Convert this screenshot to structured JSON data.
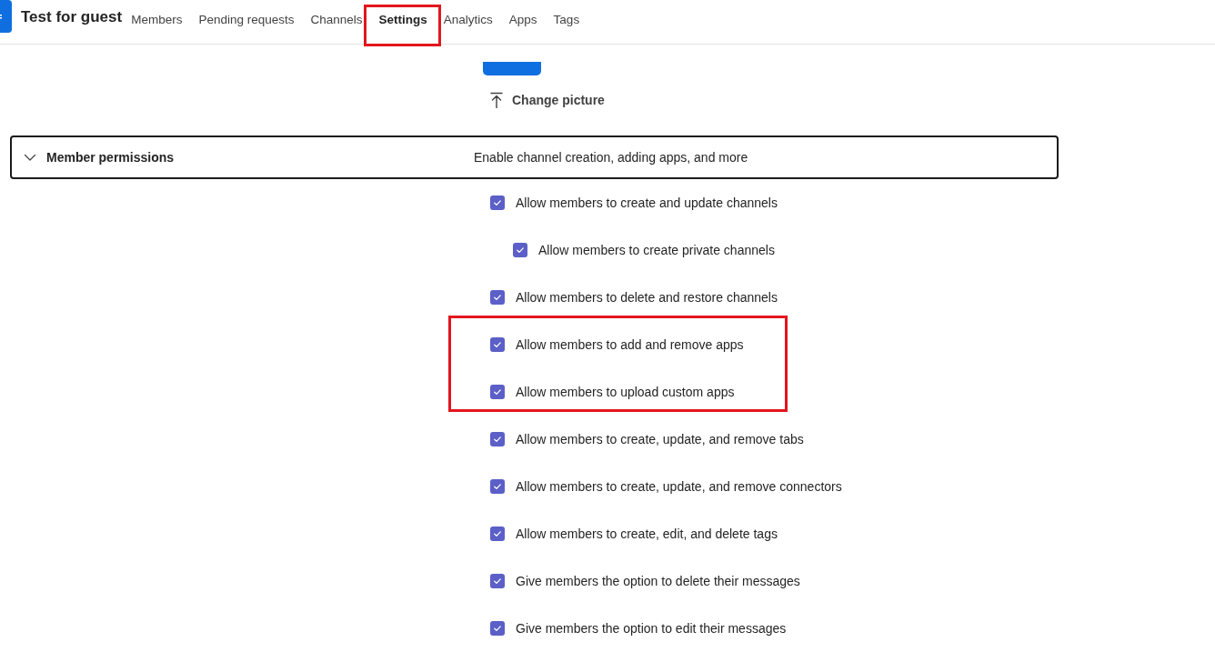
{
  "header": {
    "title": "Test for guest",
    "tabs": [
      {
        "label": "Members",
        "selected": false,
        "highlighted": false
      },
      {
        "label": "Pending requests",
        "selected": false,
        "highlighted": false
      },
      {
        "label": "Channels",
        "selected": false,
        "highlighted": false
      },
      {
        "label": "Settings",
        "selected": true,
        "highlighted": true
      },
      {
        "label": "Analytics",
        "selected": false,
        "highlighted": false
      },
      {
        "label": "Apps",
        "selected": false,
        "highlighted": false
      },
      {
        "label": "Tags",
        "selected": false,
        "highlighted": false
      }
    ]
  },
  "picture": {
    "action": "Change picture"
  },
  "section": {
    "title": "Member permissions",
    "description": "Enable channel creation, adding apps, and more",
    "expanded": true,
    "permissions": [
      {
        "label": "Allow members to create and update channels",
        "checked": true,
        "highlighted": false,
        "children": [
          {
            "label": "Allow members to create private channels",
            "checked": true,
            "highlighted": false
          }
        ]
      },
      {
        "label": "Allow members to delete and restore channels",
        "checked": true,
        "highlighted": false
      },
      {
        "label": "Allow members to add and remove apps",
        "checked": true,
        "highlighted": true
      },
      {
        "label": "Allow members to upload custom apps",
        "checked": true,
        "highlighted": true
      },
      {
        "label": "Allow members to create, update, and remove tabs",
        "checked": true,
        "highlighted": false
      },
      {
        "label": "Allow members to create, update, and remove connectors",
        "checked": true,
        "highlighted": false
      },
      {
        "label": "Allow members to create, edit, and delete tags",
        "checked": true,
        "highlighted": false
      },
      {
        "label": "Give members the option to delete their messages",
        "checked": true,
        "highlighted": false
      },
      {
        "label": "Give members the option to edit their messages",
        "checked": true,
        "highlighted": false
      }
    ]
  }
}
